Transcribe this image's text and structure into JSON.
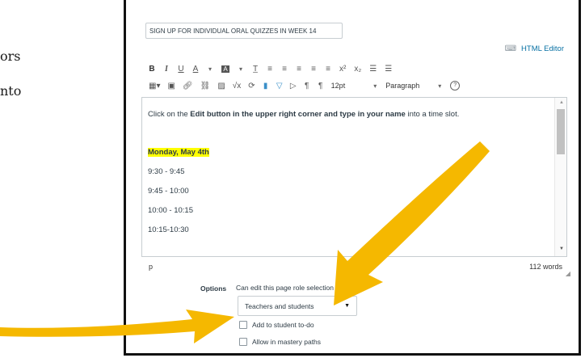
{
  "left_fragments": {
    "line1": "ors",
    "line2": "nto"
  },
  "page_title_value": "SIGN UP FOR INDIVIDUAL ORAL QUIZZES IN WEEK 14",
  "html_editor_label": "HTML Editor",
  "toolbar": {
    "row1": [
      "B",
      "I",
      "U",
      "A",
      "▾",
      "A",
      "▾",
      "T̲",
      "≡",
      "≡",
      "≡",
      "≡",
      "≡",
      "x²",
      "x₂",
      "☰",
      "☰"
    ],
    "row2_icons": [
      "table-icon",
      "media-icon",
      "link-icon",
      "unlink-icon",
      "image-icon",
      "math-icon",
      "embed-icon",
      "files-icon",
      "lti-icon",
      "record-icon",
      "pilcrow-ltr-icon",
      "pilcrow-rtl-icon"
    ],
    "font_size": "12pt",
    "paragraph": "Paragraph"
  },
  "content": {
    "intro_before": "Click on the ",
    "intro_bold": "Edit button in the upper right corner and type in your name",
    "intro_after": " into a time slot.",
    "date_heading": "Monday, May 4th",
    "slots": [
      "9:30 - 9:45",
      "9:45 - 10:00",
      "10:00 - 10:15",
      "10:15-10:30"
    ]
  },
  "status": {
    "path": "p",
    "word_count": "112 words"
  },
  "options": {
    "label": "Options",
    "permission_label": "Can edit this page role selection",
    "selected_role": "Teachers and students",
    "checkboxes": [
      "Add to student to-do",
      "Allow in mastery paths"
    ]
  },
  "colors": {
    "arrow": "#f5b800",
    "highlight": "#ffff00",
    "link": "#0770a3"
  }
}
